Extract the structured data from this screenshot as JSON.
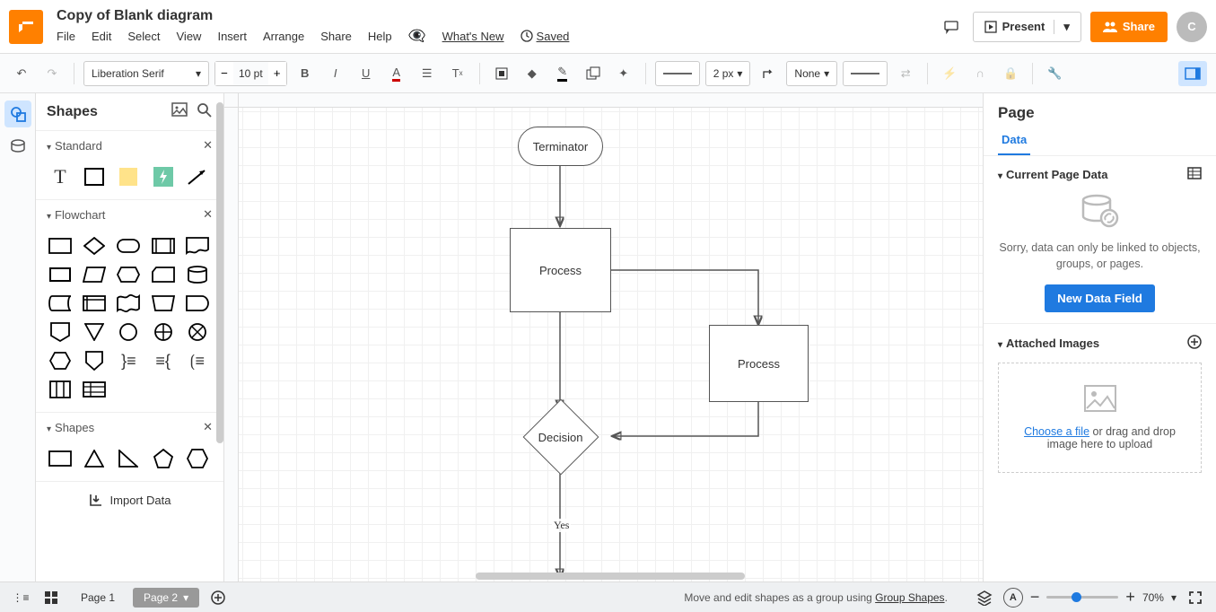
{
  "header": {
    "title": "Copy of Blank diagram",
    "menu": [
      "File",
      "Edit",
      "Select",
      "View",
      "Insert",
      "Arrange",
      "Share",
      "Help"
    ],
    "whatsnew": "What's New",
    "saved": "Saved",
    "present": "Present",
    "share": "Share",
    "avatar": "C"
  },
  "toolbar": {
    "font": "Liberation Serif",
    "fontsize": "10 pt",
    "linewidth": "2 px",
    "lineend": "None"
  },
  "shapes": {
    "title": "Shapes",
    "groups": [
      "Standard",
      "Flowchart",
      "Shapes"
    ],
    "import": "Import Data"
  },
  "canvas": {
    "nodes": {
      "terminator": "Terminator",
      "process1": "Process",
      "process2": "Process",
      "decision": "Decision"
    },
    "labels": {
      "yes": "Yes"
    }
  },
  "rightpanel": {
    "title": "Page",
    "tab": "Data",
    "section1": "Current Page Data",
    "empty_text": "Sorry, data can only be linked to objects, groups, or pages.",
    "new_field": "New Data Field",
    "section2": "Attached Images",
    "choose": "Choose a file",
    "drop_rest": " or drag and drop image here to upload"
  },
  "footer": {
    "pages": [
      "Page 1",
      "Page 2"
    ],
    "message_pre": "Move and edit shapes as a group using ",
    "message_link": "Group Shapes",
    "zoom": "70%"
  }
}
